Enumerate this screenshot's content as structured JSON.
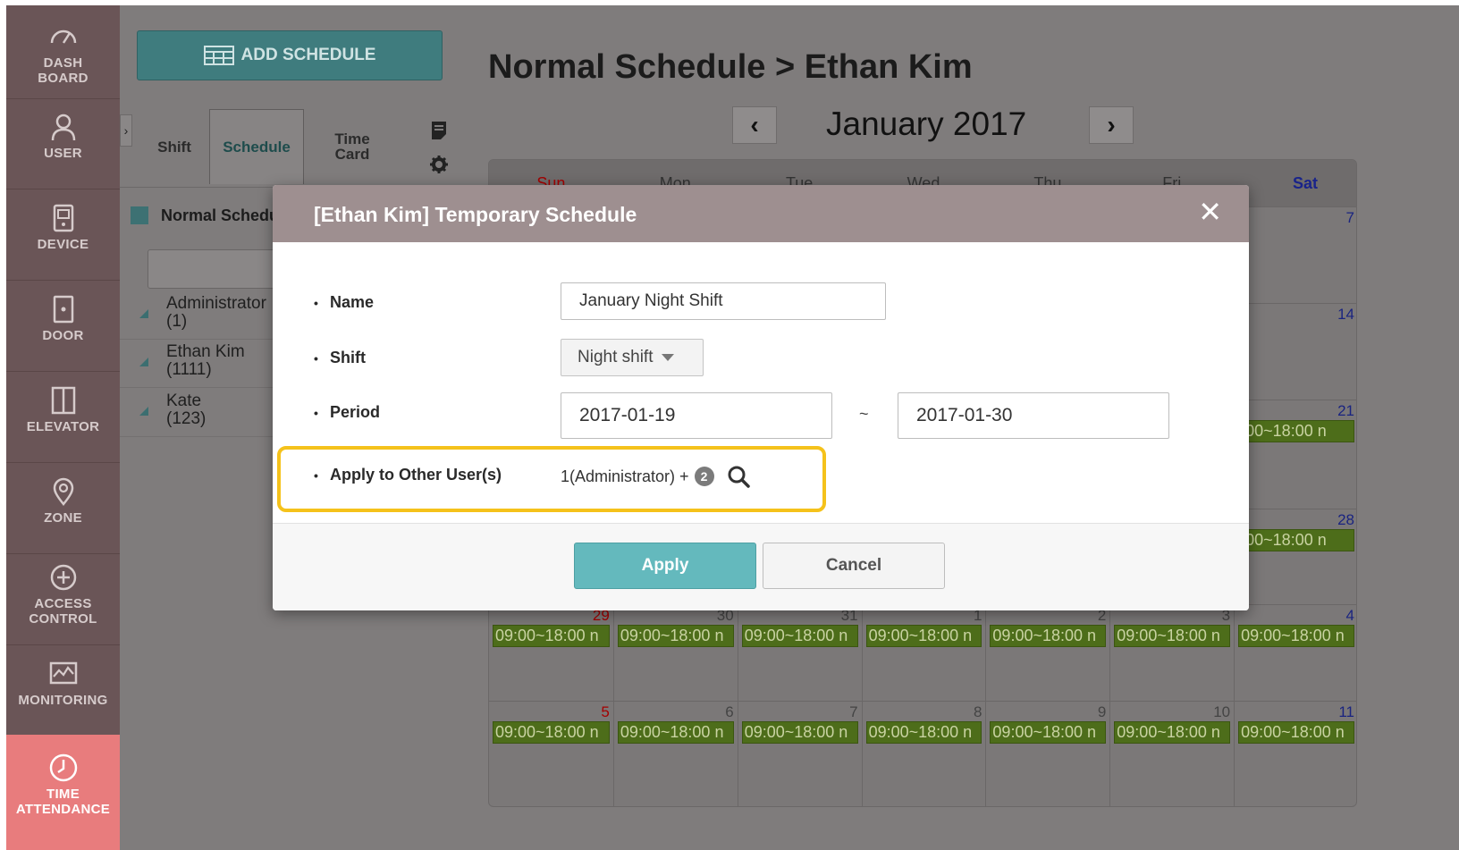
{
  "sidebar": {
    "items": [
      {
        "label": "DASH\nBOARD",
        "icon": "gauge-icon"
      },
      {
        "label": "USER",
        "icon": "user-icon"
      },
      {
        "label": "DEVICE",
        "icon": "device-icon"
      },
      {
        "label": "DOOR",
        "icon": "door-icon"
      },
      {
        "label": "ELEVATOR",
        "icon": "elevator-icon"
      },
      {
        "label": "ZONE",
        "icon": "location-pin-icon"
      },
      {
        "label": "ACCESS\nCONTROL",
        "icon": "access-control-icon"
      },
      {
        "label": "MONITORING",
        "icon": "monitoring-icon"
      },
      {
        "label": "TIME\nATTENDANCE",
        "icon": "clock-icon",
        "active": true
      }
    ]
  },
  "panel": {
    "add_label": "ADD SCHEDULE",
    "tabs": {
      "shift": "Shift",
      "schedule": "Schedule",
      "timecard": "Time\nCard"
    },
    "tree_title": "Normal Schedu",
    "users": [
      {
        "name": "Administrator",
        "id": "(1)"
      },
      {
        "name": "Ethan Kim",
        "id": "(1111)"
      },
      {
        "name": "Kate",
        "id": "(123)"
      }
    ]
  },
  "main": {
    "title": "Normal Schedule > Ethan Kim",
    "month": "January 2017",
    "weekdays": [
      "Sun",
      "Mon",
      "Tue",
      "Wed",
      "Thu",
      "Fri",
      "Sat"
    ],
    "event_label": "09:00~18:00 n",
    "event_label_short": ":00~18:00 n",
    "weeks": [
      {
        "days": [
          "",
          "",
          "",
          "",
          "",
          "",
          "7"
        ]
      },
      {
        "days": [
          "",
          "",
          "",
          "",
          "",
          "",
          "14"
        ]
      },
      {
        "days": [
          "",
          "",
          "",
          "",
          "",
          "",
          "21"
        ]
      },
      {
        "days": [
          "",
          "",
          "",
          "",
          "",
          "",
          "28"
        ]
      },
      {
        "days": [
          "29",
          "30",
          "31",
          "1",
          "2",
          "3",
          "4"
        ]
      },
      {
        "days": [
          "5",
          "6",
          "7",
          "8",
          "9",
          "10",
          "11"
        ]
      }
    ]
  },
  "modal": {
    "title": "[Ethan Kim] Temporary Schedule",
    "close": "✕",
    "labels": {
      "name": "Name",
      "shift": "Shift",
      "period": "Period",
      "apply_users": "Apply to Other User(s)"
    },
    "bullet": "•",
    "name_value": "January Night Shift",
    "shift_value": "Night shift",
    "period_start": "2017-01-19",
    "period_sep": "~",
    "period_end": "2017-01-30",
    "apply_users_text": "1(Administrator) +",
    "apply_users_count": "2",
    "apply_button": "Apply",
    "cancel_button": "Cancel"
  },
  "colors": {
    "accent_teal": "#64b9bd",
    "highlight": "#f5c21b",
    "sidebar_active": "#e87c7d",
    "event_green": "#4d6d1a"
  }
}
